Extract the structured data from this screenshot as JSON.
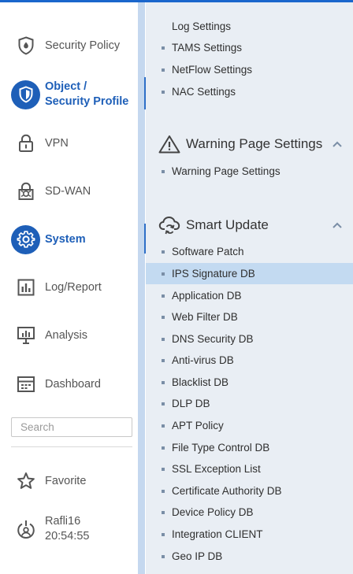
{
  "nav": {
    "items": [
      {
        "label": "Security Policy",
        "icon": "shield-icon"
      },
      {
        "label_line1": "Object /",
        "label_line2": "Security Profile",
        "icon": "shield-check-icon",
        "active": true
      },
      {
        "label": "VPN",
        "icon": "lock-icon"
      },
      {
        "label": "SD-WAN",
        "icon": "sdwan-lock-icon"
      },
      {
        "label": "System",
        "icon": "gear-icon",
        "active": true
      },
      {
        "label": "Log/Report",
        "icon": "bar-chart-icon"
      },
      {
        "label": "Analysis",
        "icon": "monitor-chart-icon"
      },
      {
        "label": "Dashboard",
        "icon": "dashboard-icon"
      }
    ],
    "search_placeholder": "Search",
    "favorite_label": "Favorite",
    "user": {
      "name": "Rafli16",
      "time": "20:54:55"
    }
  },
  "panel": {
    "clipped_item": "Log Settings",
    "top_items": [
      "TAMS Settings",
      "NetFlow Settings",
      "NAC Settings"
    ],
    "warning_section": {
      "title": "Warning Page Settings",
      "icon": "warning-triangle-icon",
      "items": [
        "Warning Page Settings"
      ]
    },
    "smart_update_section": {
      "title": "Smart Update",
      "icon": "cloud-sync-icon",
      "selected": "IPS Signature DB",
      "items": [
        "Software Patch",
        "IPS Signature DB",
        "Application DB",
        "Web Filter DB",
        "DNS Security DB",
        "Anti-virus DB",
        "Blacklist DB",
        "DLP DB",
        "APT Policy",
        "File Type Control DB",
        "SSL Exception List",
        "Certificate Authority DB",
        "Device Policy DB",
        "Integration CLIENT",
        "Geo IP DB"
      ]
    }
  },
  "colors": {
    "accent": "#1e5fb8",
    "panel_bg": "#e9eef4",
    "strip": "#c5d8ef",
    "selected_bg": "#c3daf1",
    "top_bar": "#1a66cc"
  }
}
